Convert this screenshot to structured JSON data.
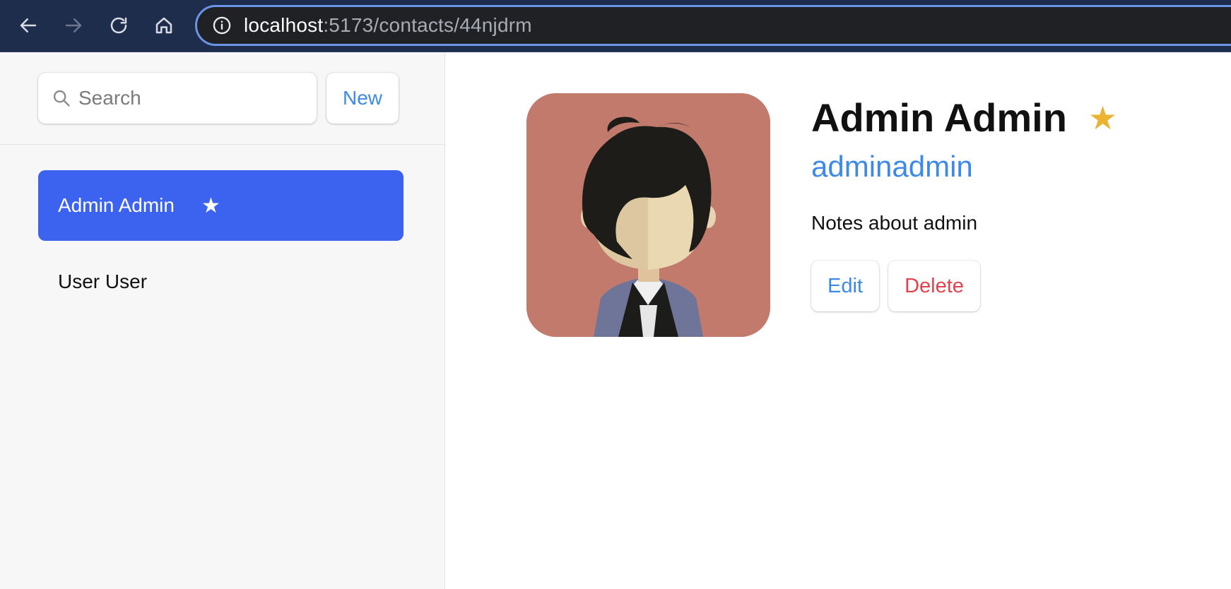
{
  "browser": {
    "url_host": "localhost",
    "url_rest": ":5173/contacts/44njdrm",
    "icons": [
      "back-arrow-icon",
      "forward-arrow-icon",
      "reload-icon",
      "home-icon",
      "info-icon"
    ]
  },
  "sidebar": {
    "search_placeholder": "Search",
    "new_label": "New",
    "contacts": [
      {
        "name": "Admin Admin",
        "favorite": true,
        "active": true,
        "star": "★"
      },
      {
        "name": "User User",
        "favorite": false,
        "active": false
      }
    ]
  },
  "contact": {
    "name": "Admin Admin",
    "favorite_star": "★",
    "username": "adminadmin",
    "notes": "Notes about admin",
    "edit_label": "Edit",
    "delete_label": "Delete"
  },
  "colors": {
    "toolbar_bg": "#1f2d4d",
    "accent_blue": "#3d89e8",
    "active_item": "#3c63f0",
    "star_gold": "#ebb331",
    "delete_red": "#e0434e",
    "avatar_bg": "#c27a6c"
  }
}
